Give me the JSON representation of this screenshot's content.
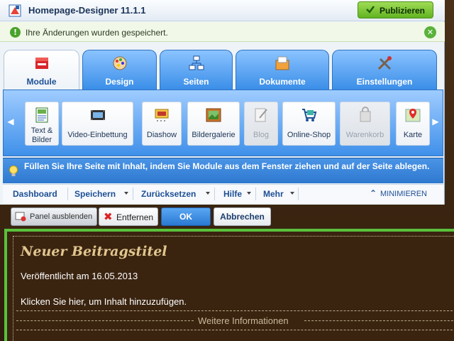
{
  "app": {
    "title": "Homepage-Designer 11.1.1",
    "publish_label": "Publizieren"
  },
  "notice": {
    "text": "Ihre Änderungen wurden gespeichert."
  },
  "tabs": [
    {
      "label": "Module",
      "icon": "modules-icon",
      "active": true
    },
    {
      "label": "Design",
      "icon": "palette-icon",
      "active": false
    },
    {
      "label": "Seiten",
      "icon": "sitemap-icon",
      "active": false
    },
    {
      "label": "Dokumente",
      "icon": "documents-icon",
      "active": false
    },
    {
      "label": "Einstellungen",
      "icon": "tools-icon",
      "active": false
    }
  ],
  "modules": [
    {
      "label": "Text & Bilder",
      "icon": "text-image-icon",
      "enabled": true
    },
    {
      "label": "Video-Einbettung",
      "icon": "video-icon",
      "enabled": true
    },
    {
      "label": "Diashow",
      "icon": "slideshow-icon",
      "enabled": true
    },
    {
      "label": "Bildergalerie",
      "icon": "gallery-icon",
      "enabled": true
    },
    {
      "label": "Blog",
      "icon": "blog-icon",
      "enabled": false
    },
    {
      "label": "Online-Shop",
      "icon": "shop-icon",
      "enabled": true
    },
    {
      "label": "Warenkorb",
      "icon": "cart-icon",
      "enabled": false
    },
    {
      "label": "Karte",
      "icon": "map-icon",
      "enabled": true
    }
  ],
  "hint": {
    "text": "Füllen Sie Ihre Seite mit Inhalt, indem Sie Module aus dem Fenster ziehen und auf der Seite ablegen."
  },
  "menubar": {
    "dashboard": "Dashboard",
    "save": "Speichern",
    "undo": "Zurücksetzen",
    "help": "Hilfe",
    "more": "Mehr",
    "minimize": "MINIMIEREN"
  },
  "actions": {
    "panel_hide": "Panel ausblenden",
    "remove": "Entfernen",
    "ok": "OK",
    "cancel": "Abbrechen"
  },
  "post": {
    "title": "Neuer Beitragstitel",
    "date": "Veröffentlicht am 16.05.2013",
    "body": "Klicken Sie hier, um Inhalt hinzuzufügen.",
    "more": "Weitere Informationen"
  },
  "colors": {
    "accent_blue": "#3a8ee8",
    "publish_green": "#62b321",
    "site_bg": "#3a2410",
    "post_title": "#e1c68f",
    "edit_border": "#59c13c"
  }
}
